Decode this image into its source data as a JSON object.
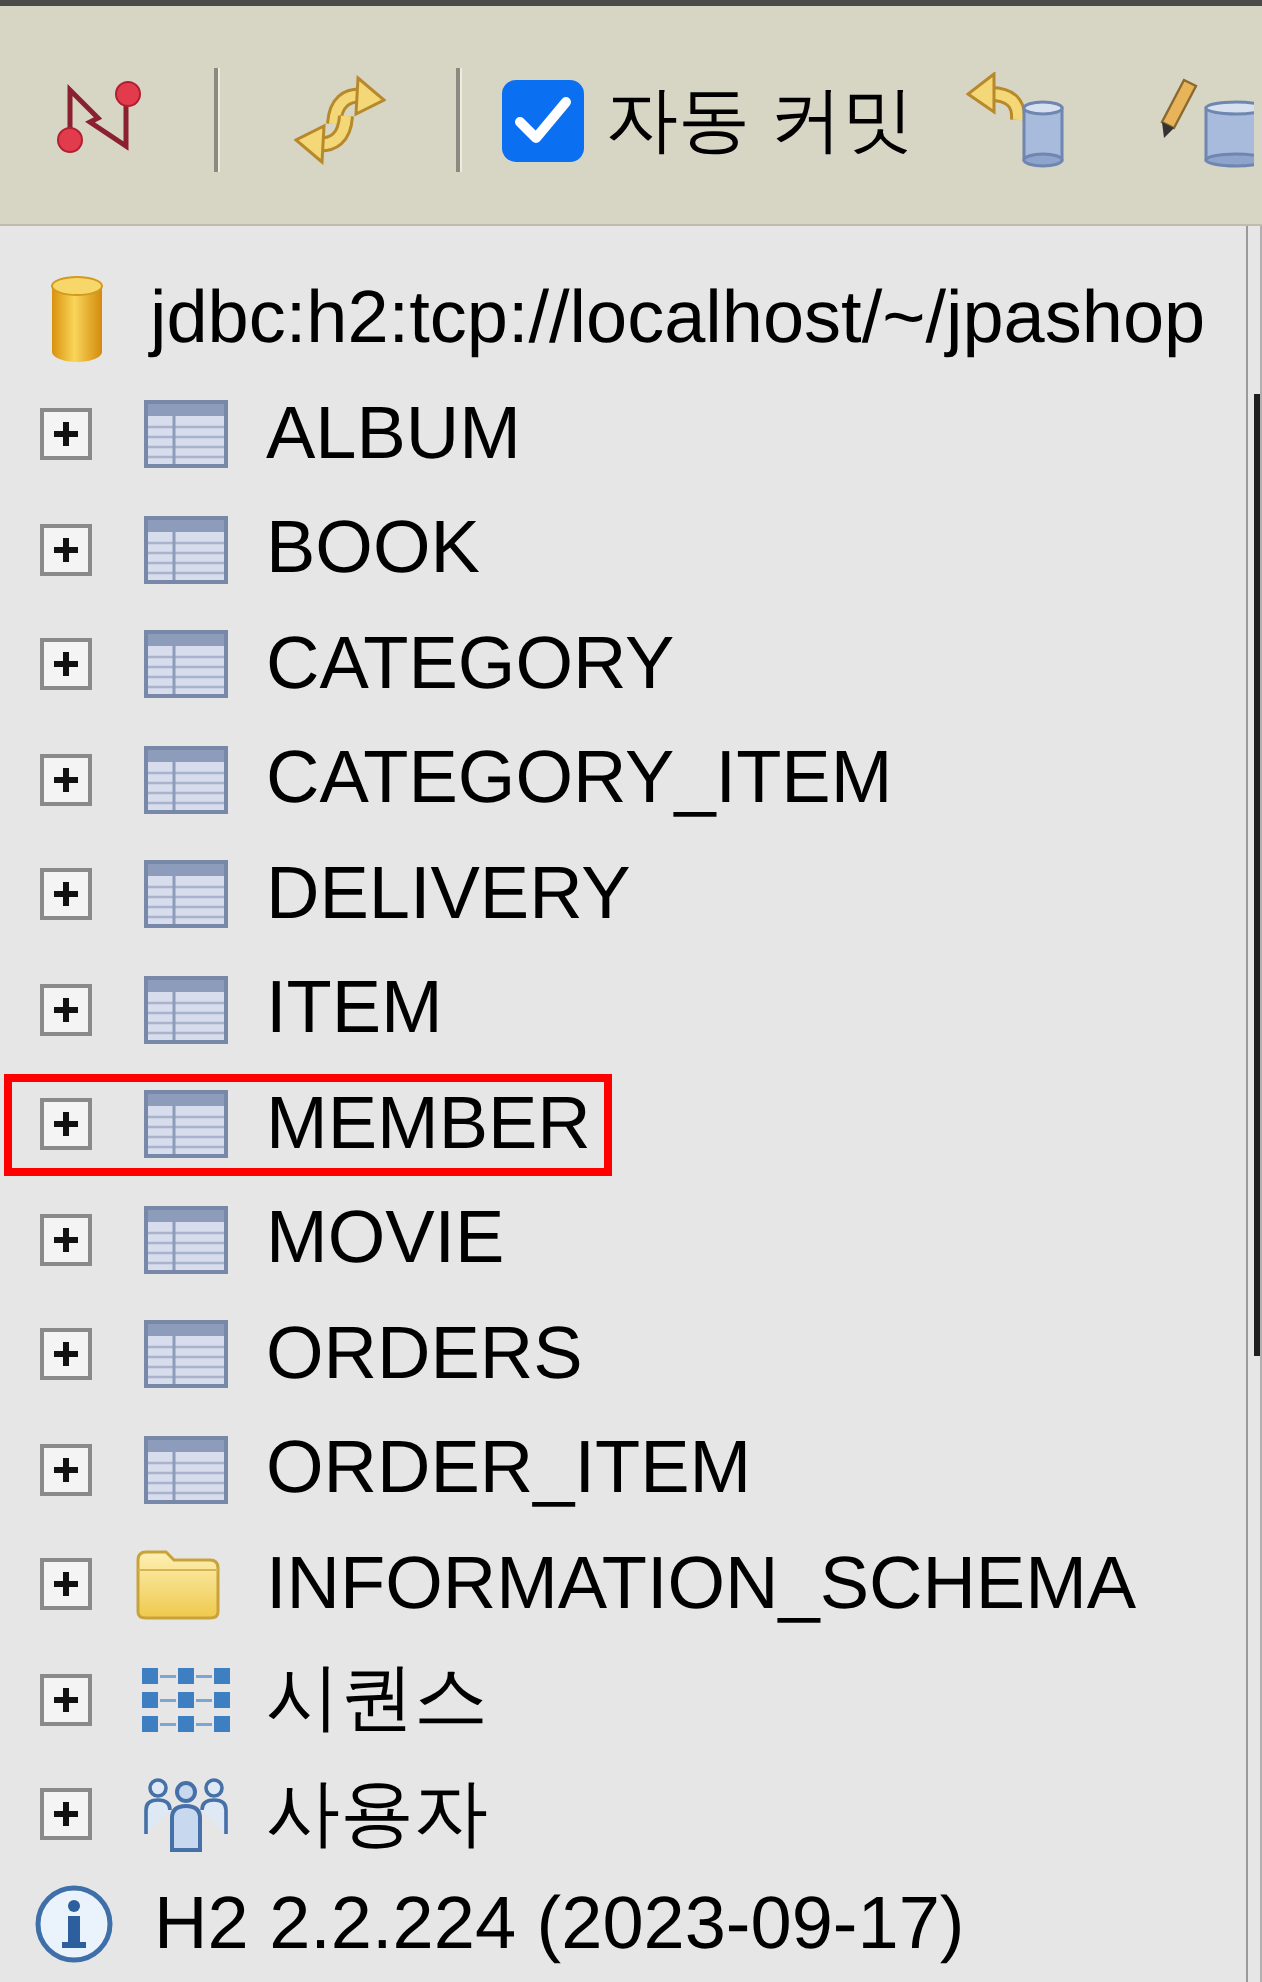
{
  "toolbar": {
    "auto_commit": {
      "label": "자동 커밋",
      "checked": true
    }
  },
  "tree": {
    "connection": "jdbc:h2:tcp://localhost/~/jpashop",
    "items": [
      {
        "kind": "table",
        "label": "ALBUM",
        "expanded": false,
        "highlighted": false
      },
      {
        "kind": "table",
        "label": "BOOK",
        "expanded": false,
        "highlighted": false
      },
      {
        "kind": "table",
        "label": "CATEGORY",
        "expanded": false,
        "highlighted": false
      },
      {
        "kind": "table",
        "label": "CATEGORY_ITEM",
        "expanded": false,
        "highlighted": false
      },
      {
        "kind": "table",
        "label": "DELIVERY",
        "expanded": false,
        "highlighted": false
      },
      {
        "kind": "table",
        "label": "ITEM",
        "expanded": false,
        "highlighted": false
      },
      {
        "kind": "table",
        "label": "MEMBER",
        "expanded": false,
        "highlighted": true
      },
      {
        "kind": "table",
        "label": "MOVIE",
        "expanded": false,
        "highlighted": false
      },
      {
        "kind": "table",
        "label": "ORDERS",
        "expanded": false,
        "highlighted": false
      },
      {
        "kind": "table",
        "label": "ORDER_ITEM",
        "expanded": false,
        "highlighted": false
      },
      {
        "kind": "schema",
        "label": "INFORMATION_SCHEMA",
        "expanded": false,
        "highlighted": false
      },
      {
        "kind": "sequences",
        "label": "시퀀스",
        "expanded": false,
        "highlighted": false
      },
      {
        "kind": "users",
        "label": "사용자",
        "expanded": false,
        "highlighted": false
      }
    ],
    "version": "H2 2.2.224 (2023-09-17)"
  }
}
